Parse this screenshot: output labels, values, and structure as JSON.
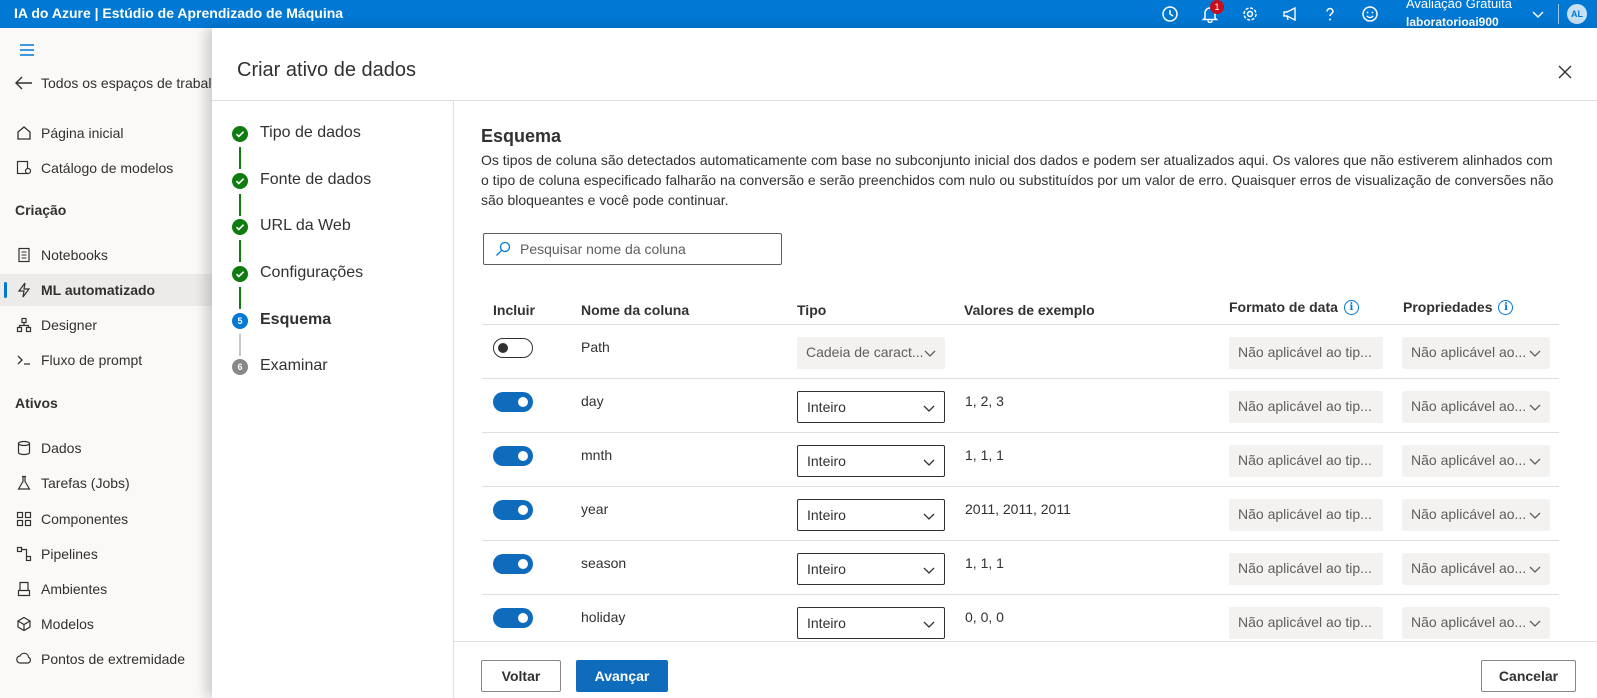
{
  "app": {
    "title": "IA do Azure | Estúdio de Aprendizado de Máquina"
  },
  "topbar": {
    "icons": [
      "clock-icon",
      "bell-icon",
      "gear-icon",
      "megaphone-icon",
      "help-icon",
      "smiley-icon"
    ],
    "notification_count": "1",
    "account_line1": "Avaliação Gratuita",
    "account_line2": "laboratorioai900",
    "avatar_initials": "AL"
  },
  "leftnav": {
    "back_label": "Todos os espaços de trabal",
    "items_top": [
      {
        "label": "Página inicial",
        "icon": "home-icon"
      },
      {
        "label": "Catálogo de modelos",
        "icon": "catalog-icon"
      }
    ],
    "section_creation": "Criação",
    "items_creation": [
      {
        "label": "Notebooks",
        "icon": "notebook-icon"
      },
      {
        "label": "ML automatizado",
        "icon": "automl-icon"
      },
      {
        "label": "Designer",
        "icon": "designer-icon"
      },
      {
        "label": "Fluxo de prompt",
        "icon": "prompt-flow-icon"
      }
    ],
    "section_assets": "Ativos",
    "items_assets": [
      {
        "label": "Dados",
        "icon": "data-icon"
      },
      {
        "label": "Tarefas (Jobs)",
        "icon": "jobs-icon"
      },
      {
        "label": "Componentes",
        "icon": "components-icon"
      },
      {
        "label": "Pipelines",
        "icon": "pipelines-icon"
      },
      {
        "label": "Ambientes",
        "icon": "environments-icon"
      },
      {
        "label": "Modelos",
        "icon": "models-icon"
      },
      {
        "label": "Pontos de extremidade",
        "icon": "endpoints-icon"
      }
    ]
  },
  "panel": {
    "title": "Criar ativo de dados",
    "steps": [
      {
        "label": "Tipo de dados",
        "state": "done"
      },
      {
        "label": "Fonte de dados",
        "state": "done"
      },
      {
        "label": "URL da Web",
        "state": "done"
      },
      {
        "label": "Configurações",
        "state": "done"
      },
      {
        "label": "Esquema",
        "state": "current",
        "number": "5"
      },
      {
        "label": "Examinar",
        "state": "todo",
        "number": "6"
      }
    ],
    "schema": {
      "title": "Esquema",
      "description": "Os tipos de coluna são detectados automaticamente com base no subconjunto inicial dos dados e podem ser atualizados aqui. Os valores que não estiverem alinhados com o tipo de coluna especificado falharão na conversão e serão preenchidos com nulo ou substituídos por um valor de erro. Quaisquer erros de visualização de conversões não são bloqueantes e você pode continuar.",
      "search_placeholder": "Pesquisar nome da coluna",
      "headers": {
        "include": "Incluir",
        "column_name": "Nome da coluna",
        "type": "Tipo",
        "sample_values": "Valores de exemplo",
        "date_format": "Formato de data",
        "properties": "Propriedades"
      },
      "rows": [
        {
          "include": false,
          "name": "Path",
          "type": "Cadeia de caract...",
          "type_disabled": true,
          "sample": "",
          "date_format": "Não aplicável ao tip...",
          "properties": "Não aplicável ao..."
        },
        {
          "include": true,
          "name": "day",
          "type": "Inteiro",
          "type_disabled": false,
          "sample": "1, 2, 3",
          "date_format": "Não aplicável ao tip...",
          "properties": "Não aplicável ao..."
        },
        {
          "include": true,
          "name": "mnth",
          "type": "Inteiro",
          "type_disabled": false,
          "sample": "1, 1, 1",
          "date_format": "Não aplicável ao tip...",
          "properties": "Não aplicável ao..."
        },
        {
          "include": true,
          "name": "year",
          "type": "Inteiro",
          "type_disabled": false,
          "sample": "2011, 2011, 2011",
          "date_format": "Não aplicável ao tip...",
          "properties": "Não aplicável ao..."
        },
        {
          "include": true,
          "name": "season",
          "type": "Inteiro",
          "type_disabled": false,
          "sample": "1, 1, 1",
          "date_format": "Não aplicável ao tip...",
          "properties": "Não aplicável ao..."
        },
        {
          "include": true,
          "name": "holiday",
          "type": "Inteiro",
          "type_disabled": false,
          "sample": "0, 0, 0",
          "date_format": "Não aplicável ao tip...",
          "properties": "Não aplicável ao..."
        }
      ]
    },
    "footer": {
      "back_label": "Voltar",
      "next_label": "Avançar",
      "cancel_label": "Cancelar"
    }
  },
  "colors": {
    "brand": "#0078d4",
    "primary_button": "#0f6cbd",
    "step_done": "#107c10",
    "badge": "#c50f1f"
  }
}
